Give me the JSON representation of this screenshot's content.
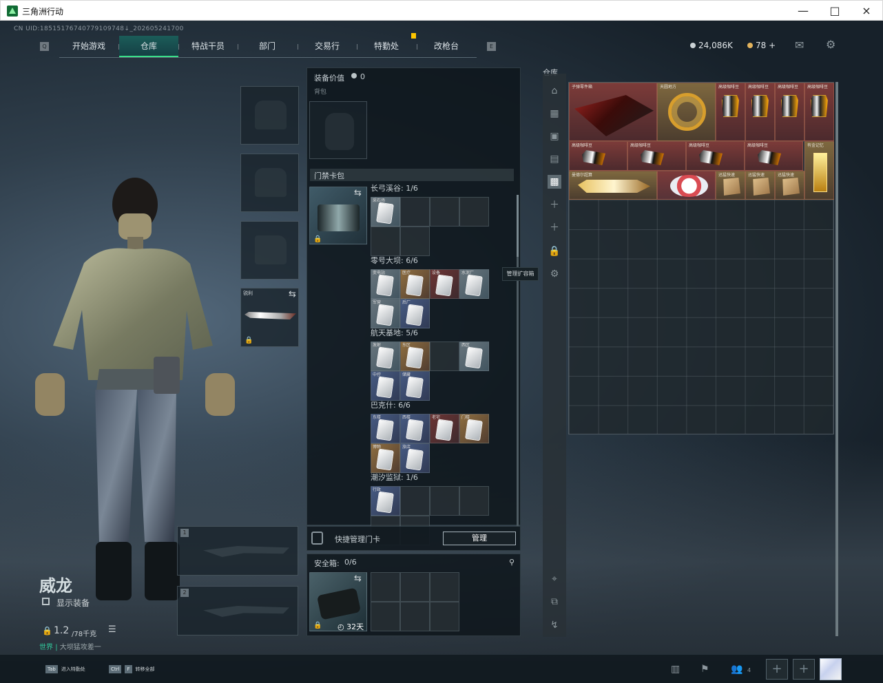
{
  "window": {
    "title": "三角洲行动"
  },
  "header": {
    "uid": "CN UID:18515176740779109748↓_202605241700",
    "tabs": [
      "开始游戏",
      "仓库",
      "特战干员",
      "部门",
      "交易行",
      "特勤处",
      "改枪台"
    ],
    "left_key": "Q",
    "right_key": "E",
    "silver": "24,086K",
    "gold": "78"
  },
  "character": {
    "name": "威龙",
    "show_gear": "显示装备",
    "weight": "1.2",
    "weight_max": "/78千克",
    "status_prefix": "世界",
    "status_text": "大坝猛攻差一"
  },
  "loadout": {
    "knife_label": "锐利",
    "primary_label": "1",
    "secondary_label": "2"
  },
  "equipment": {
    "value_label": "装备价值",
    "value": "0",
    "backpack_label": "背包",
    "cardpack_label": "门禁卡包",
    "maps": [
      {
        "name": "长弓溪谷",
        "count": "1/6",
        "items": [
          "采石场"
        ],
        "style": [
          "card"
        ]
      },
      {
        "name": "零号大坝",
        "count": "6/6",
        "items": [
          "变电站",
          "医疗",
          "设备",
          "水泥厂",
          "军营",
          "后厂"
        ],
        "style": [
          "card",
          "gold",
          "red",
          "card",
          "card",
          "blue"
        ]
      },
      {
        "name": "航天基地",
        "count": "5/6",
        "items": [
          "发射",
          "东区",
          "",
          "西区",
          "中控",
          "储藏"
        ],
        "style": [
          "card",
          "gold",
          "empty",
          "card",
          "blue",
          "blue"
        ]
      },
      {
        "name": "巴克什",
        "count": "6/6",
        "items": [
          "东楼",
          "西楼",
          "老宅",
          "门楼",
          "博物",
          "旅店"
        ],
        "style": [
          "blue",
          "blue",
          "red",
          "gold",
          "gold",
          "blue"
        ]
      },
      {
        "name": "潮汐监狱",
        "count": "1/6",
        "items": [
          "行政"
        ],
        "style": [
          "blue"
        ]
      }
    ],
    "quick_manage": "快捷管理门卡",
    "manage_button": "管理",
    "tooltip": "管理扩容箱",
    "safe_box_label": "安全箱:",
    "safe_box_value": "0/6",
    "safe_days": "32天"
  },
  "warehouse": {
    "title": "仓库",
    "items": [
      "子弹零件箱",
      "天圆地方",
      "高级咖啡豆",
      "高级咖啡豆",
      "高级咖啡豆",
      "高级咖啡豆",
      "高级咖啡豆",
      "高级咖啡豆",
      "高级咖啡豆",
      "高级咖啡豆",
      "有金记忆",
      "曼德尔超算",
      "",
      "迅猛快速",
      "迅猛快速",
      "迅猛快速"
    ]
  },
  "bottom": {
    "tab_key": "Tab",
    "tab_label": "进入特勤处",
    "ctrl_key": "Ctrl",
    "f_key": "F",
    "ctrl_label": "转移全部",
    "social_count": "4"
  },
  "icons": {
    "mail": "mail-icon",
    "settings": "gear-icon",
    "lock": "lock-icon",
    "clock": "clock-icon",
    "swap": "swap-icon"
  }
}
